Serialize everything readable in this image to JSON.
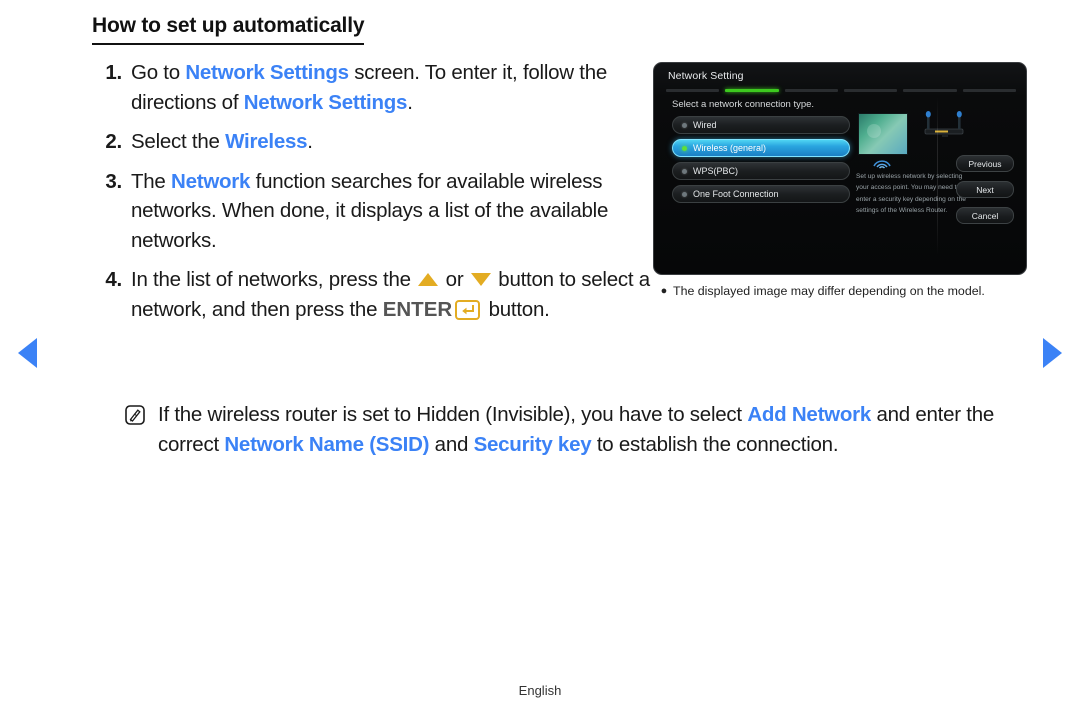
{
  "heading": "How to set up automatically",
  "nav": {
    "prev_icon": "triangle-left-icon",
    "next_icon": "triangle-right-icon",
    "accent": "#3b82f6"
  },
  "steps": [
    {
      "num": "1.",
      "parts": [
        {
          "t": "Go to ",
          "style": "plain"
        },
        {
          "t": "Network Settings",
          "style": "blue"
        },
        {
          "t": " screen. To enter it, follow the directions of ",
          "style": "plain"
        },
        {
          "t": "Network Settings",
          "style": "blue"
        },
        {
          "t": ".",
          "style": "plain"
        }
      ]
    },
    {
      "num": "2.",
      "parts": [
        {
          "t": "Select the ",
          "style": "plain"
        },
        {
          "t": "Wireless",
          "style": "blue"
        },
        {
          "t": ".",
          "style": "plain"
        }
      ]
    },
    {
      "num": "3.",
      "parts": [
        {
          "t": "The ",
          "style": "plain"
        },
        {
          "t": "Network",
          "style": "blue"
        },
        {
          "t": " function searches for available wireless networks. When done, it displays a list of the available networks.",
          "style": "plain"
        }
      ]
    },
    {
      "num": "4.",
      "parts": [
        {
          "t": "In the list of networks, press the ",
          "style": "plain"
        },
        {
          "t": "",
          "style": "tri-up"
        },
        {
          "t": " or ",
          "style": "plain"
        },
        {
          "t": "",
          "style": "tri-down"
        },
        {
          "t": " button to select a network, and then press the ",
          "style": "plain"
        },
        {
          "t": "ENTER",
          "style": "enter"
        },
        {
          "t": "",
          "style": "enter-icon"
        },
        {
          "t": " button.",
          "style": "plain"
        }
      ]
    }
  ],
  "note": {
    "icon": "note-pencil-icon",
    "parts": [
      {
        "t": "If the wireless router is set to Hidden (Invisible), you have to select ",
        "style": "plain"
      },
      {
        "t": "Add Network",
        "style": "blue"
      },
      {
        "t": " and enter the correct ",
        "style": "plain"
      },
      {
        "t": "Network Name (SSID)",
        "style": "blue"
      },
      {
        "t": " and ",
        "style": "plain"
      },
      {
        "t": "Security key",
        "style": "blue"
      },
      {
        "t": " to establish the connection.",
        "style": "plain"
      }
    ]
  },
  "tv": {
    "title": "Network Setting",
    "progress": {
      "segments": 6,
      "active_index": 1,
      "active_color": "#3dc91f"
    },
    "prompt": "Select a network connection type.",
    "options": [
      {
        "label": "Wired",
        "selected": false
      },
      {
        "label": "Wireless (general)",
        "selected": true
      },
      {
        "label": "WPS(PBC)",
        "selected": false
      },
      {
        "label": "One Foot Connection",
        "selected": false
      }
    ],
    "description": "Set up wireless network by selecting your access point. You may need to enter a security key depending on the settings of the Wireless Router.",
    "buttons": [
      {
        "label": "Previous"
      },
      {
        "label": "Next"
      },
      {
        "label": "Cancel"
      }
    ],
    "illustration": {
      "tv_icon": "tv-screen-icon",
      "wifi_icon": "wifi-waves-icon",
      "router_icon": "wireless-router-icon"
    }
  },
  "caption": {
    "bullet": "●",
    "text": "The displayed image may differ depending on the model."
  },
  "footer": {
    "language": "English"
  }
}
